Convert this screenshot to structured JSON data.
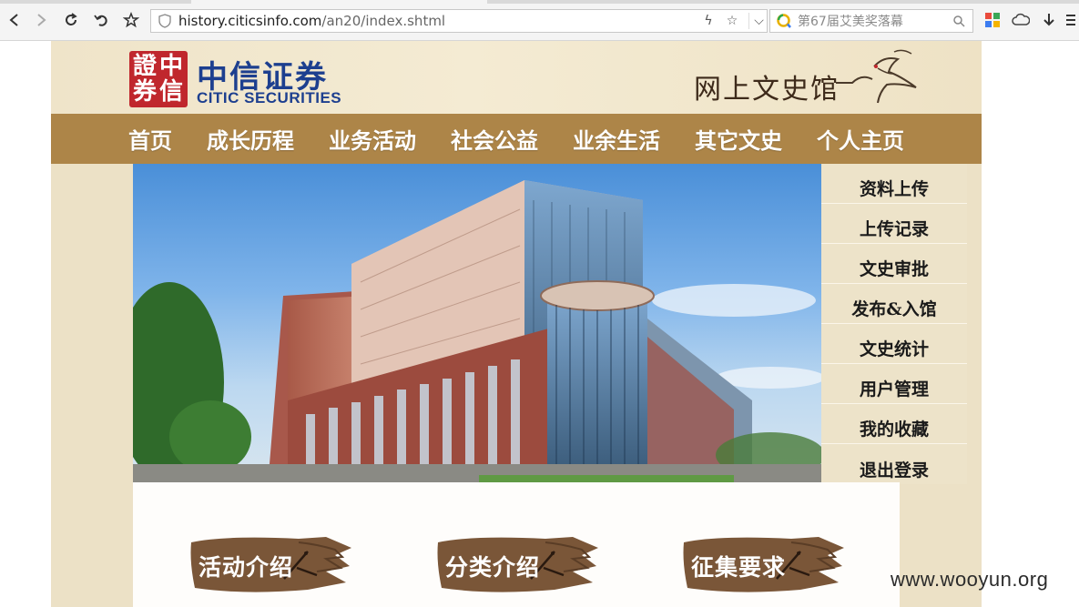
{
  "browser": {
    "url_host": "history.citicsinfo.com",
    "url_path": "/an20/index.shtml",
    "search_text": "第67届艾美奖落幕"
  },
  "header": {
    "seal_chars": [
      "證",
      "中",
      "券",
      "信"
    ],
    "logo_cn": "中信证券",
    "logo_en": "CITIC SECURITIES",
    "site_name": "网上文史馆"
  },
  "nav": {
    "items": [
      {
        "label": "首页"
      },
      {
        "label": "成长历程"
      },
      {
        "label": "业务活动"
      },
      {
        "label": "社会公益"
      },
      {
        "label": "业余生活"
      },
      {
        "label": "其它文史"
      },
      {
        "label": "个人主页"
      }
    ]
  },
  "side_menu": {
    "items": [
      {
        "label": "资料上传"
      },
      {
        "label": "上传记录"
      },
      {
        "label": "文史审批"
      },
      {
        "label": "发布&入馆"
      },
      {
        "label": "文史统计"
      },
      {
        "label": "用户管理"
      },
      {
        "label": "我的收藏"
      },
      {
        "label": "退出登录"
      }
    ]
  },
  "intro_buttons": [
    {
      "label": "活动介绍"
    },
    {
      "label": "分类介绍"
    },
    {
      "label": "征集要求"
    }
  ],
  "watermark": "www.wooyun.org",
  "colors": {
    "nav_bg": "#ad8548",
    "brand_blue": "#1d3f8f",
    "seal_red": "#c0272d",
    "page_bg": "#ece1c6"
  }
}
